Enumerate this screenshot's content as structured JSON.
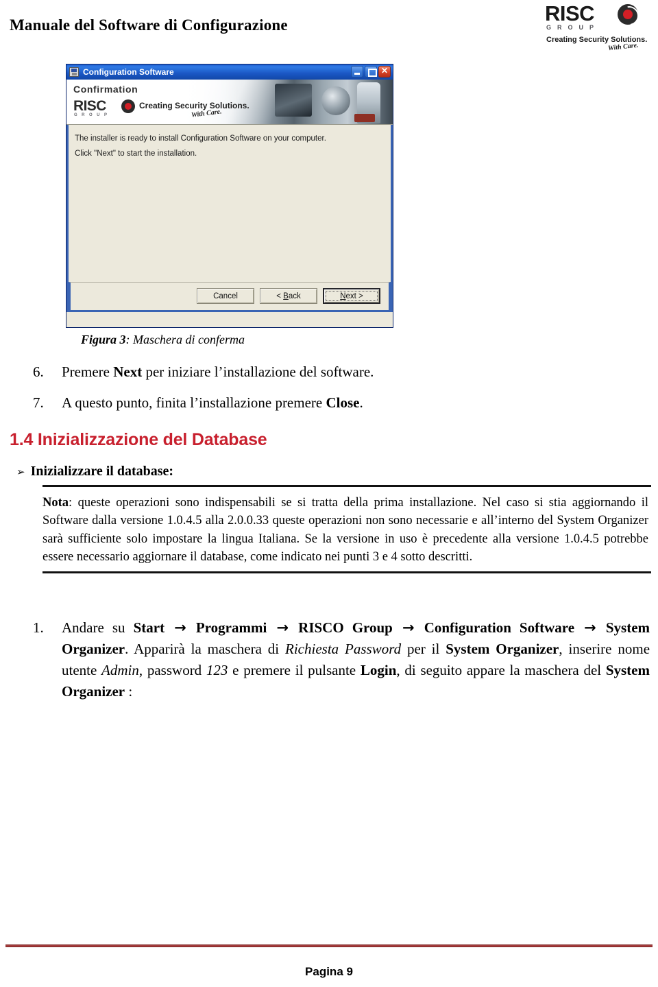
{
  "header": {
    "title": "Manuale del Software di Configurazione",
    "logo": {
      "wordmark": "RISC",
      "group": "GROUP",
      "tagline": "Creating Security Solutions.",
      "care": "With Care."
    }
  },
  "dialog": {
    "title": "Configuration Software",
    "banner_heading": "Confirmation",
    "banner_logo": {
      "wordmark": "RISC",
      "group": "GROUP",
      "tagline": "Creating Security Solutions.",
      "care": "With Care."
    },
    "body_line_1": "The installer is ready to install Configuration Software on your computer.",
    "body_line_2": "Click \"Next\" to start the installation.",
    "buttons": {
      "cancel": "Cancel",
      "back_prefix": "< ",
      "back_accel": "B",
      "back_suffix": "ack",
      "next_prefix": "",
      "next_accel": "N",
      "next_suffix": "ext >"
    },
    "window_controls": {
      "minimize": "Minimize",
      "maximize": "Maximize",
      "close": "Close"
    }
  },
  "caption": {
    "label": "Figura 3",
    "separator": ": ",
    "text": "Maschera di conferma"
  },
  "list": {
    "item6": {
      "marker": "6.",
      "pre": "Premere ",
      "bold": "Next",
      "post": " per iniziare l’installazione del software."
    },
    "item7": {
      "marker": "7.",
      "pre": "A questo punto, finita l’installazione premere ",
      "bold": "Close",
      "post": "."
    }
  },
  "section": {
    "heading": "1.4 Inizializzazione del Database",
    "bullet_glyph": "➢",
    "bullet_text": "Inizializzare il database:"
  },
  "nota": {
    "label": "Nota",
    "text": ": queste operazioni sono indispensabili se si tratta della prima installazione. Nel caso si stia aggiornando il Software dalla versione 1.0.4.5 alla 2.0.0.33 queste operazioni non sono necessarie e all’interno del System Organizer sarà sufficiente solo impostare la lingua Italiana. Se la versione in uso è precedente alla versione 1.0.4.5 potrebbe essere necessario aggiornare il database, come indicato nei punti 3 e 4 sotto descritti."
  },
  "final_step": {
    "marker": "1.",
    "p1": "Andare su ",
    "b1": "Start",
    "arrow1": " → ",
    "b2": "Programmi",
    "arrow2": " → ",
    "b3": "RISCO Group",
    "arrow3": " → ",
    "b4": "Configuration Software",
    "arrow4": " → ",
    "b5": "System Organizer",
    "p2": ". Apparirà la maschera di ",
    "i1": "Richiesta Password",
    "p3": " per il ",
    "b6": "System Organizer",
    "p4": ", inserire nome utente ",
    "i2": "Admin",
    "p5": ", password ",
    "i3": "123",
    "p6": " e premere il pulsante ",
    "b7": "Login",
    "p7": ", di seguito appare la maschera del ",
    "b8": "System Organizer",
    "p8": " :"
  },
  "footer": {
    "page_label": "Pagina 9"
  },
  "colors": {
    "heading_red": "#C8202E",
    "footer_rule_red": "#A33B3B",
    "logo_red": "#d21f26",
    "dialog_body": "#ece9dc",
    "titlebar_blue": "#1a57c4"
  }
}
